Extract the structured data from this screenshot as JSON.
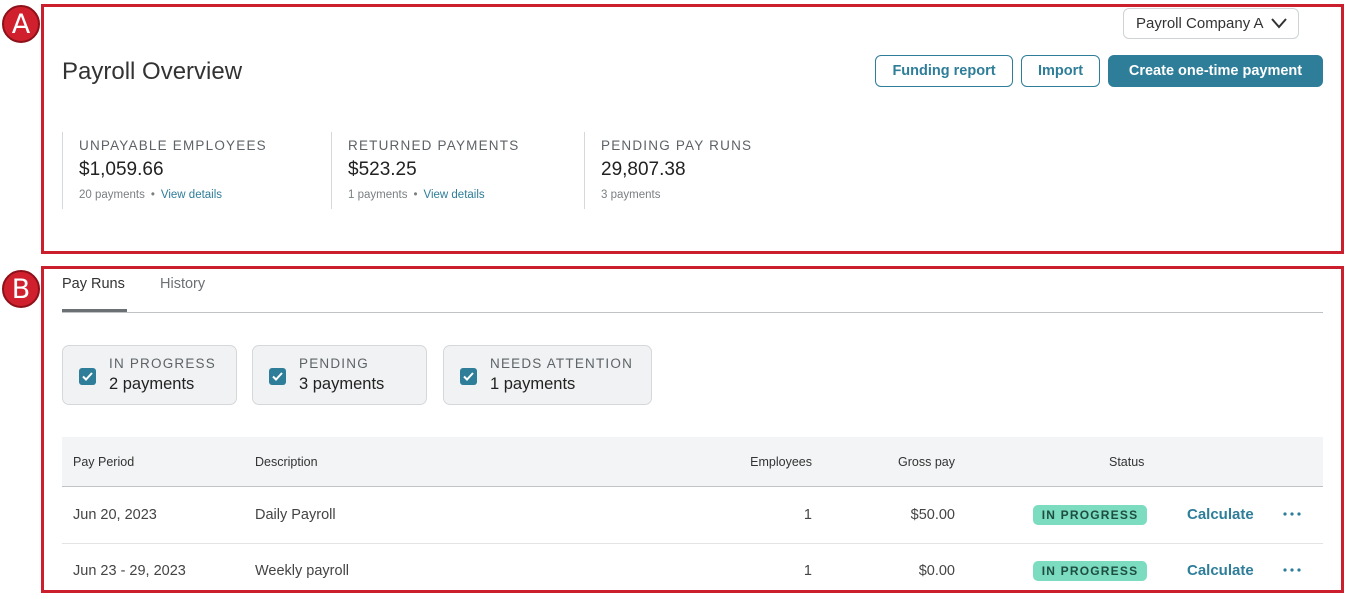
{
  "callouts": {
    "a": "A",
    "b": "B"
  },
  "header": {
    "company_select": "Payroll Company A",
    "title": "Payroll Overview",
    "funding_report": "Funding report",
    "import": "Import",
    "create_payment": "Create one-time payment"
  },
  "stats": [
    {
      "label": "UNPAYABLE EMPLOYEES",
      "value": "$1,059.66",
      "count": "20 payments",
      "link": "View details"
    },
    {
      "label": "RETURNED PAYMENTS",
      "value": "$523.25",
      "count": "1 payments",
      "link": "View details"
    },
    {
      "label": "PENDING PAY RUNS",
      "value": "29,807.38",
      "count": "3 payments"
    }
  ],
  "tabs": [
    {
      "label": "Pay Runs",
      "active": true
    },
    {
      "label": "History",
      "active": false
    }
  ],
  "filters": [
    {
      "title": "IN PROGRESS",
      "count": "2 payments",
      "checked": true
    },
    {
      "title": "PENDING",
      "count": "3 payments",
      "checked": true
    },
    {
      "title": "NEEDS ATTENTION",
      "count": "1 payments",
      "checked": true
    }
  ],
  "table": {
    "columns": [
      "Pay Period",
      "Description",
      "Employees",
      "Gross pay",
      "Status"
    ],
    "rows": [
      {
        "period": "Jun 20, 2023",
        "description": "Daily Payroll",
        "employees": "1",
        "gross": "$50.00",
        "status": "IN PROGRESS",
        "action": "Calculate"
      },
      {
        "period": "Jun 23 - 29, 2023",
        "description": "Weekly payroll",
        "employees": "1",
        "gross": "$0.00",
        "status": "IN PROGRESS",
        "action": "Calculate"
      }
    ]
  },
  "colors": {
    "accent": "#2e7d99",
    "callout": "#cc1f2d",
    "status_pill": "#7bdcbf"
  },
  "icons": {
    "select": "chevron-down-icon",
    "checkbox": "checkmark-icon",
    "row_menu": "more-horizontal-icon"
  }
}
